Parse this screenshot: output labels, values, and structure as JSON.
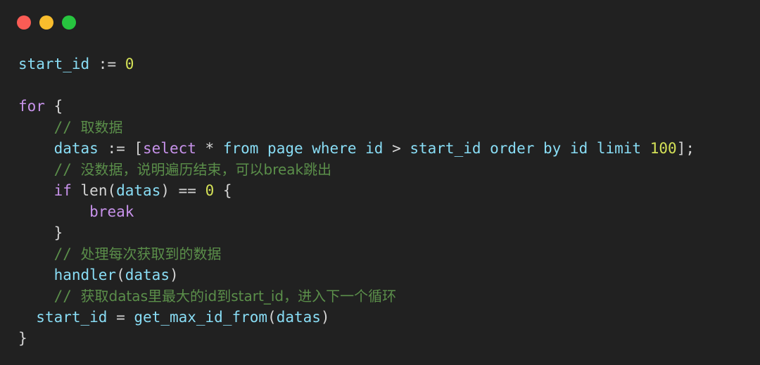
{
  "window": {
    "theme": "dark-code-snippet",
    "background_color": "#212121",
    "controls": [
      {
        "name": "close",
        "color": "#fb5c55"
      },
      {
        "name": "minimize",
        "color": "#f8bd2d"
      },
      {
        "name": "maximize",
        "color": "#27c53f"
      }
    ]
  },
  "palette": {
    "keyword": "#c792ea",
    "identifier": "#89ddf5",
    "plain": "#d4d4d4",
    "number": "#d4e157",
    "comment": "#5b8f4a"
  },
  "code": {
    "language": "go",
    "lines": [
      {
        "n": 1,
        "text": "start_id := 0",
        "tokens": [
          {
            "t": "start_id",
            "c": "ident"
          },
          {
            "t": " := ",
            "c": "plain"
          },
          {
            "t": "0",
            "c": "num"
          }
        ]
      },
      {
        "n": 2,
        "text": "",
        "tokens": []
      },
      {
        "n": 3,
        "text": "for {",
        "tokens": [
          {
            "t": "for",
            "c": "kw"
          },
          {
            "t": " {",
            "c": "plain"
          }
        ]
      },
      {
        "n": 4,
        "text": "    // 取数据",
        "tokens": [
          {
            "t": "    ",
            "c": "plain"
          },
          {
            "t": "// ",
            "c": "comment"
          },
          {
            "t": "取数据",
            "c": "comment-cjk"
          }
        ]
      },
      {
        "n": 5,
        "text": "    datas := [select * from page where id > start_id order by id limit 100];",
        "tokens": [
          {
            "t": "    ",
            "c": "plain"
          },
          {
            "t": "datas",
            "c": "ident"
          },
          {
            "t": " := [",
            "c": "plain"
          },
          {
            "t": "select",
            "c": "kw"
          },
          {
            "t": " ",
            "c": "plain"
          },
          {
            "t": "*",
            "c": "plain"
          },
          {
            "t": " ",
            "c": "plain"
          },
          {
            "t": "from page where id",
            "c": "ident"
          },
          {
            "t": " > ",
            "c": "plain"
          },
          {
            "t": "start_id order by id limit",
            "c": "ident"
          },
          {
            "t": " ",
            "c": "plain"
          },
          {
            "t": "100",
            "c": "num"
          },
          {
            "t": "];",
            "c": "plain"
          }
        ]
      },
      {
        "n": 6,
        "text": "    // 没数据，说明遍历结束，可以break跳出",
        "tokens": [
          {
            "t": "    ",
            "c": "plain"
          },
          {
            "t": "// ",
            "c": "comment"
          },
          {
            "t": "没数据，说明遍历结束，可以break跳出",
            "c": "comment-cjk"
          }
        ]
      },
      {
        "n": 7,
        "text": "    if len(datas) == 0 {",
        "tokens": [
          {
            "t": "    ",
            "c": "plain"
          },
          {
            "t": "if",
            "c": "kw"
          },
          {
            "t": " ",
            "c": "plain"
          },
          {
            "t": "len",
            "c": "plain"
          },
          {
            "t": "(",
            "c": "plain"
          },
          {
            "t": "datas",
            "c": "ident"
          },
          {
            "t": ") == ",
            "c": "plain"
          },
          {
            "t": "0",
            "c": "num"
          },
          {
            "t": " {",
            "c": "plain"
          }
        ]
      },
      {
        "n": 8,
        "text": "        break",
        "tokens": [
          {
            "t": "        ",
            "c": "plain"
          },
          {
            "t": "break",
            "c": "kw"
          }
        ]
      },
      {
        "n": 9,
        "text": "    }",
        "tokens": [
          {
            "t": "    }",
            "c": "plain"
          }
        ]
      },
      {
        "n": 10,
        "text": "    // 处理每次获取到的数据",
        "tokens": [
          {
            "t": "    ",
            "c": "plain"
          },
          {
            "t": "// ",
            "c": "comment"
          },
          {
            "t": "处理每次获取到的数据",
            "c": "comment-cjk"
          }
        ]
      },
      {
        "n": 11,
        "text": "    handler(datas)",
        "tokens": [
          {
            "t": "    ",
            "c": "plain"
          },
          {
            "t": "handler",
            "c": "fn"
          },
          {
            "t": "(",
            "c": "plain"
          },
          {
            "t": "datas",
            "c": "ident"
          },
          {
            "t": ")",
            "c": "plain"
          }
        ]
      },
      {
        "n": 12,
        "text": "    // 获取datas里最大的id到start_id，进入下一个循环",
        "tokens": [
          {
            "t": "    ",
            "c": "plain"
          },
          {
            "t": "// ",
            "c": "comment"
          },
          {
            "t": "获取datas里最大的id到start_id，进入下一个循环",
            "c": "comment-cjk"
          }
        ]
      },
      {
        "n": 13,
        "text": "  start_id = get_max_id_from(datas)",
        "tokens": [
          {
            "t": "  ",
            "c": "plain"
          },
          {
            "t": "start_id",
            "c": "ident"
          },
          {
            "t": " = ",
            "c": "plain"
          },
          {
            "t": "get_max_id_from",
            "c": "fn"
          },
          {
            "t": "(",
            "c": "plain"
          },
          {
            "t": "datas",
            "c": "ident"
          },
          {
            "t": ")",
            "c": "plain"
          }
        ]
      },
      {
        "n": 14,
        "text": "}",
        "tokens": [
          {
            "t": "}",
            "c": "plain"
          }
        ]
      }
    ]
  }
}
